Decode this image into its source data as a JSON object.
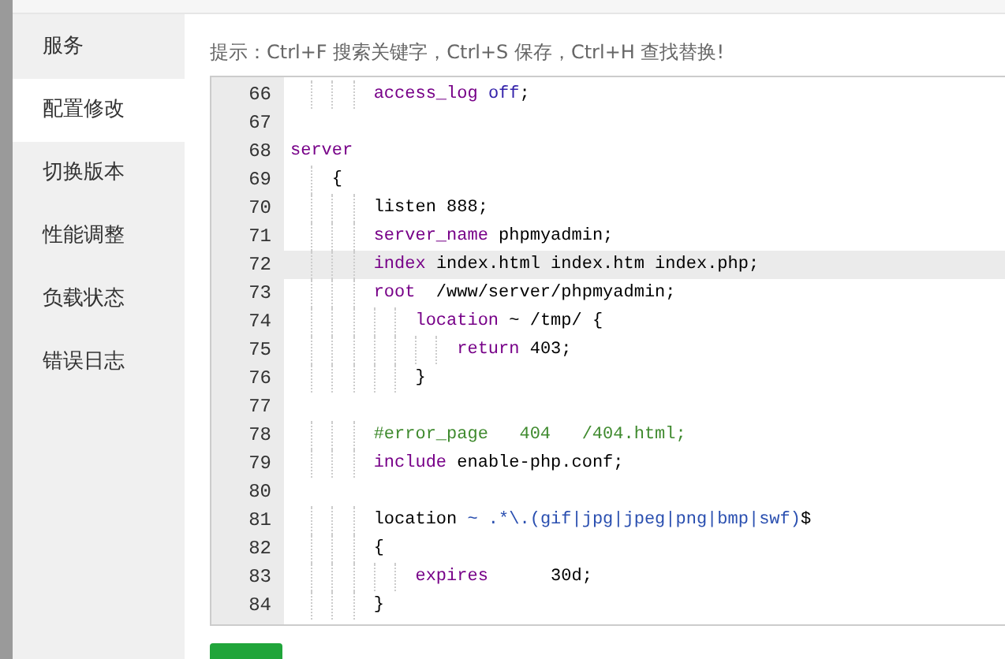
{
  "sidebar": {
    "items": [
      {
        "label": "服务",
        "selected": false
      },
      {
        "label": "配置修改",
        "selected": true
      },
      {
        "label": "切换版本",
        "selected": false
      },
      {
        "label": "性能调整",
        "selected": false
      },
      {
        "label": "负载状态",
        "selected": false
      },
      {
        "label": "错误日志",
        "selected": false
      }
    ]
  },
  "hint": "提示：Ctrl+F 搜索关键字，Ctrl+S 保存，Ctrl+H 查找替换!",
  "editor": {
    "lines": [
      {
        "number": "66",
        "active": false,
        "tokens": [
          {
            "kind": "keyword",
            "text": "        access_log"
          },
          {
            "kind": "atom",
            "text": " off"
          },
          {
            "kind": "plain",
            "text": ";"
          }
        ]
      },
      {
        "number": "67",
        "active": false
      },
      {
        "number": "68",
        "active": false,
        "tokens": [
          {
            "kind": "keyword",
            "text": "server"
          }
        ]
      },
      {
        "number": "69",
        "active": false,
        "tokens": [
          {
            "kind": "plain",
            "text": "    {"
          }
        ]
      },
      {
        "number": "70",
        "active": false,
        "tokens": [
          {
            "kind": "plain",
            "text": "        listen 888;"
          }
        ]
      },
      {
        "number": "71",
        "active": false,
        "tokens": [
          {
            "kind": "keyword",
            "text": "        server_name"
          },
          {
            "kind": "plain",
            "text": " phpmyadmin;"
          }
        ]
      },
      {
        "number": "72",
        "active": true,
        "tokens": [
          {
            "kind": "keyword",
            "text": "        index"
          },
          {
            "kind": "plain",
            "text": " index.html index.htm index.php;"
          }
        ]
      },
      {
        "number": "73",
        "active": false,
        "tokens": [
          {
            "kind": "keyword",
            "text": "        root"
          },
          {
            "kind": "plain",
            "text": "  /www/server/phpmyadmin;"
          }
        ]
      },
      {
        "number": "74",
        "active": false,
        "tokens": [
          {
            "kind": "keyword",
            "text": "            location"
          },
          {
            "kind": "plain",
            "text": " ~ /tmp/ {"
          }
        ]
      },
      {
        "number": "75",
        "active": false,
        "tokens": [
          {
            "kind": "keyword",
            "text": "                return"
          },
          {
            "kind": "plain",
            "text": " 403;"
          }
        ]
      },
      {
        "number": "76",
        "active": false,
        "tokens": [
          {
            "kind": "plain",
            "text": "            }"
          }
        ]
      },
      {
        "number": "77",
        "active": false
      },
      {
        "number": "78",
        "active": false,
        "tokens": [
          {
            "kind": "comment",
            "text": "        #error_page   404   /404.html;"
          }
        ]
      },
      {
        "number": "79",
        "active": false,
        "tokens": [
          {
            "kind": "keyword",
            "text": "        include"
          },
          {
            "kind": "plain",
            "text": " enable-php.conf;"
          }
        ]
      },
      {
        "number": "80",
        "active": false
      },
      {
        "number": "81",
        "active": false,
        "tokens": [
          {
            "kind": "plain",
            "text": "        location"
          },
          {
            "kind": "regex",
            "text": " ~ .*\\.(gif|jpg|jpeg|png|bmp|swf)"
          },
          {
            "kind": "plain",
            "text": "$"
          }
        ]
      },
      {
        "number": "82",
        "active": false,
        "tokens": [
          {
            "kind": "plain",
            "text": "        {"
          }
        ]
      },
      {
        "number": "83",
        "active": false,
        "tokens": [
          {
            "kind": "keyword",
            "text": "            expires"
          },
          {
            "kind": "plain",
            "text": "      30d;"
          }
        ]
      },
      {
        "number": "84",
        "active": false,
        "tokens": [
          {
            "kind": "plain",
            "text": "        }"
          }
        ]
      }
    ]
  }
}
